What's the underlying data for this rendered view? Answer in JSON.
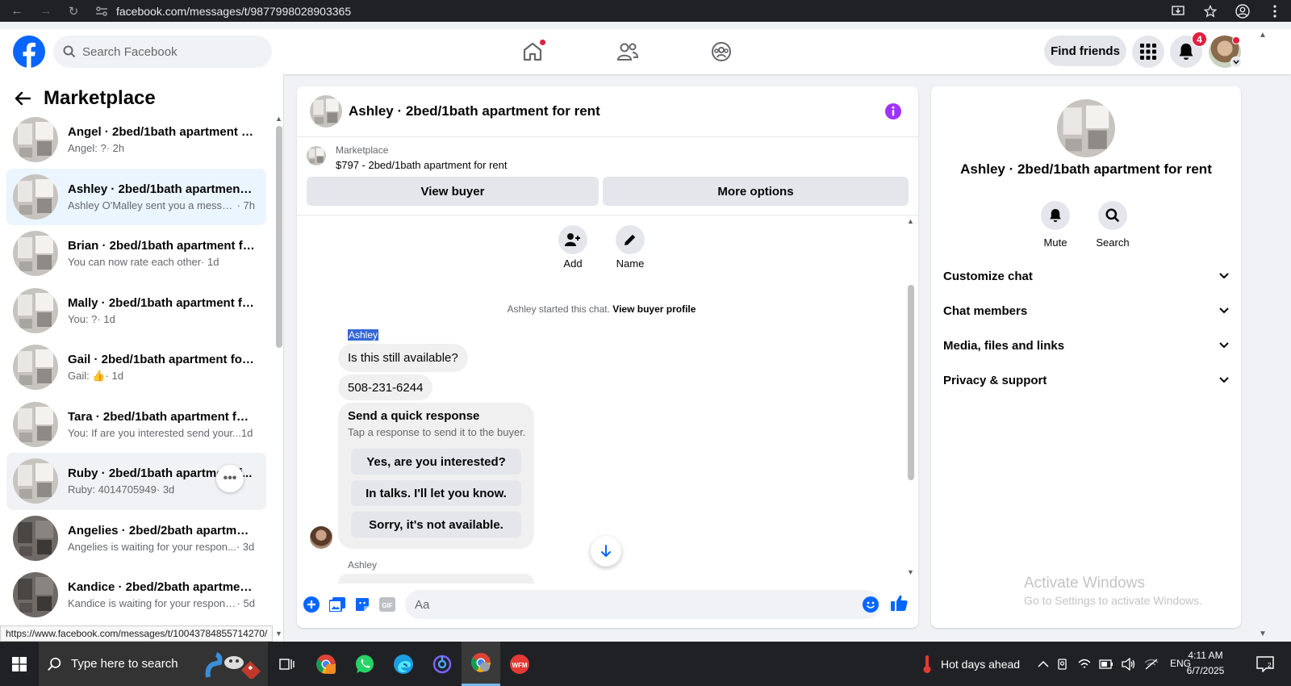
{
  "browser": {
    "url": "facebook.com/messages/t/9877998028903365",
    "status_url": "https://www.facebook.com/messages/t/10043784855714270/"
  },
  "header": {
    "search_placeholder": "Search Facebook",
    "find_friends_label": "Find friends",
    "notification_count": "4"
  },
  "left_pane": {
    "title": "Marketplace",
    "conversations": [
      {
        "title": "Angel · 2bed/1bath apartment f...",
        "preview": "Angel: ?",
        "time": " · 2h",
        "state": "normal"
      },
      {
        "title": "Ashley · 2bed/1bath apartment f...",
        "preview": "Ashley O'Malley sent you a messag...",
        "time": " · 7h",
        "state": "selected"
      },
      {
        "title": "Brian · 2bed/1bath apartment fo...",
        "preview": "You can now rate each other",
        "time": " · 1d",
        "state": "normal"
      },
      {
        "title": "Mally · 2bed/1bath apartment fo...",
        "preview": "You: ?",
        "time": " · 1d",
        "state": "normal"
      },
      {
        "title": "Gail · 2bed/1bath apartment for ...",
        "preview": "Gail: 👍",
        "time": " · 1d",
        "state": "normal"
      },
      {
        "title": "Tara · 2bed/1bath apartment for ...",
        "preview": "You: If are you interested send your...",
        "time": " 1d",
        "state": "normal"
      },
      {
        "title": "Ruby · 2bed/1bath apartment f...",
        "preview": "Ruby: 4014705949",
        "time": " · 3d",
        "state": "hover"
      },
      {
        "title": "Angelies · 2bed/2bath apartmen...",
        "preview": "Angelies is waiting for your respon...",
        "time": " · 3d",
        "state": "normal"
      },
      {
        "title": "Kandice · 2bed/2bath apartmen...",
        "preview": "Kandice is waiting for your response.",
        "time": " · 5d",
        "state": "normal"
      }
    ]
  },
  "chat": {
    "title": "Ashley · 2bed/1bath apartment for rent",
    "marketplace_label": "Marketplace",
    "item": "$797 - 2bed/1bath apartment for rent",
    "view_buyer": "View buyer",
    "more_options": "More options",
    "add_label": "Add",
    "name_label": "Name",
    "started_text": "Ashley started this chat.",
    "view_buyer_profile": "View buyer profile",
    "sender": "Ashley",
    "messages": [
      "Is this still available?",
      "508-231-6244"
    ],
    "quick_title": "Send a quick response",
    "quick_sub": "Tap a response to send it to the buyer.",
    "quick_options": [
      "Yes, are you interested?",
      "In talks. I'll let you know.",
      "Sorry, it's not available."
    ],
    "sender_bottom": "Ashley",
    "composer_placeholder": "Aa"
  },
  "right_pane": {
    "title": "Ashley · 2bed/1bath apartment for rent",
    "mute_label": "Mute",
    "search_label": "Search",
    "sections": [
      "Customize chat",
      "Chat members",
      "Media, files and links",
      "Privacy & support"
    ],
    "activate_title": "Activate Windows",
    "activate_sub": "Go to Settings to activate Windows."
  },
  "taskbar": {
    "search_placeholder": "Type here to search",
    "weather": "Hot days ahead",
    "language": "ENG",
    "time": "4:11 AM",
    "date": "6/7/2025"
  },
  "colors": {
    "facebook_blue": "#0866ff",
    "messenger_purple": "#a033ff",
    "badge_red": "#e41e3f",
    "selected_bg": "#ebf5ff"
  }
}
